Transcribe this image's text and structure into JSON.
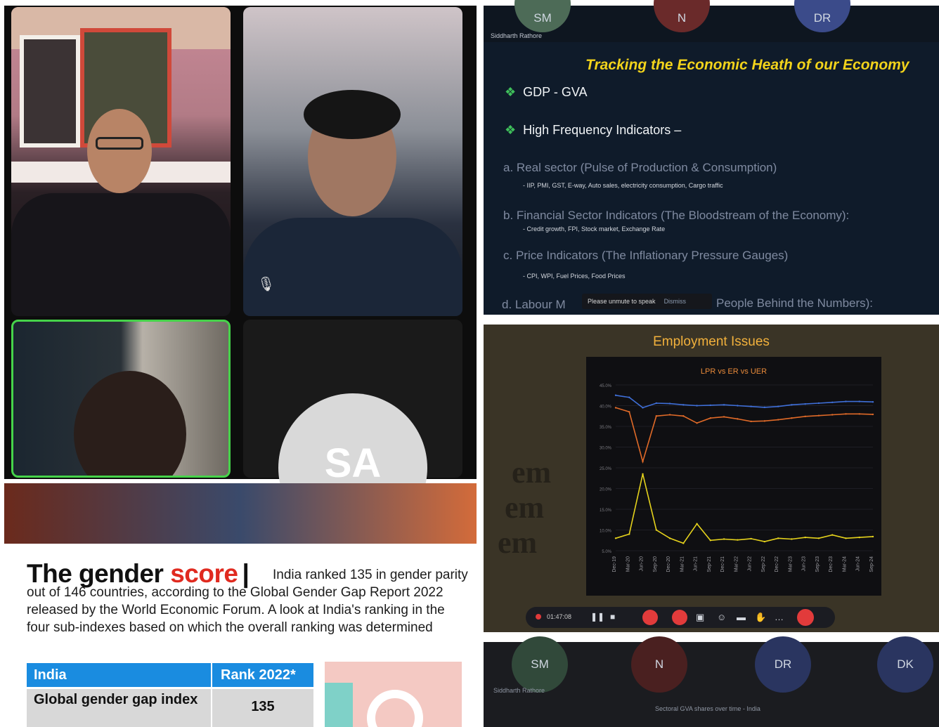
{
  "participants": {
    "tile4_initials": "SA"
  },
  "slide1": {
    "strip": {
      "bubbles": [
        "SM",
        "N",
        "DR"
      ],
      "name_label": "Siddharth Rathore"
    },
    "title": "Tracking the Economic Heath of our Economy",
    "bullets": [
      "GDP - GVA",
      "High Frequency Indicators –"
    ],
    "items": [
      {
        "label": "a.  Real sector (Pulse of Production & Consumption)",
        "detail": "- IIP, PMI, GST, E-way, Auto sales, electricity consumption, Cargo traffic"
      },
      {
        "label": "b.  Financial Sector Indicators (The Bloodstream of the Economy):",
        "detail": "- Credit growth, FPI, Stock market, Exchange Rate"
      },
      {
        "label": "c.  Price Indicators (The Inflationary Pressure Gauges)",
        "detail": "- CPI, WPI, Fuel Prices, Food Prices"
      },
      {
        "label": "d. Labour M",
        "detail": ""
      }
    ],
    "item_d_tail": "People Behind the Numbers):",
    "toast_text": "Please unmute to speak",
    "toast_action": "Dismiss"
  },
  "slide2": {
    "title": "Employment Issues",
    "timer": "01:47:08",
    "ghost_words": [
      "em",
      "em",
      "em"
    ]
  },
  "chart_data": {
    "type": "line",
    "title": "LPR vs ER vs UER",
    "x": [
      "Dec-19",
      "Mar-20",
      "Jun-20",
      "Sep-20",
      "Dec-20",
      "Mar-21",
      "Jun-21",
      "Sep-21",
      "Dec-21",
      "Mar-22",
      "Jun-22",
      "Sep-22",
      "Dec-22",
      "Mar-23",
      "Jun-23",
      "Sep-23",
      "Dec-23",
      "Mar-24",
      "Jun-24",
      "Sep-24"
    ],
    "series": [
      {
        "color": "#3f6fd8",
        "values": [
          42.5,
          42.0,
          39.5,
          40.6,
          40.5,
          40.2,
          40.0,
          40.1,
          40.2,
          40.0,
          39.8,
          39.6,
          39.8,
          40.2,
          40.4,
          40.6,
          40.8,
          41.0,
          41.0,
          40.9
        ]
      },
      {
        "color": "#e06a28",
        "values": [
          39.5,
          38.5,
          26.5,
          37.5,
          37.8,
          37.5,
          35.8,
          37.0,
          37.3,
          36.8,
          36.2,
          36.3,
          36.6,
          37.0,
          37.4,
          37.6,
          37.8,
          38.0,
          38.0,
          37.9
        ]
      },
      {
        "color": "#e5d21c",
        "values": [
          8.0,
          9.0,
          23.5,
          10.0,
          8.0,
          6.8,
          11.5,
          7.5,
          7.8,
          7.6,
          7.9,
          7.2,
          8.0,
          7.8,
          8.2,
          8.0,
          8.8,
          8.0,
          8.2,
          8.4
        ]
      }
    ],
    "ylim": [
      5,
      45
    ],
    "yticks": [
      "45.0%",
      "40.0%",
      "35.0%",
      "30.0%",
      "25.0%",
      "20.0%",
      "15.0%",
      "10.0%",
      "5.0%"
    ]
  },
  "strip_bottom": {
    "bubbles": [
      "SM",
      "N",
      "DR",
      "DK"
    ],
    "name_label": "Siddharth Rathore",
    "caption": "Sectoral GVA shares over time - India"
  },
  "article": {
    "headline_black": "The gender",
    "headline_red": "score",
    "headline_bar": "|",
    "lead": "India ranked 135 in gender parity out of 146 countries, according to the Global Gender Gap Report 2022 released by the World Economic Forum. A look at India's ranking in the four sub-indexes based on which the overall ranking was determined",
    "table": {
      "headers": [
        "India",
        "Rank 2022*"
      ],
      "rows": [
        [
          "Global gender gap index",
          "135"
        ]
      ]
    }
  },
  "colors": {
    "speaking_border": "#46d34a",
    "slide_title": "#f2d31b",
    "accent_red": "#e02a1f",
    "table_header": "#1a8ce0"
  }
}
